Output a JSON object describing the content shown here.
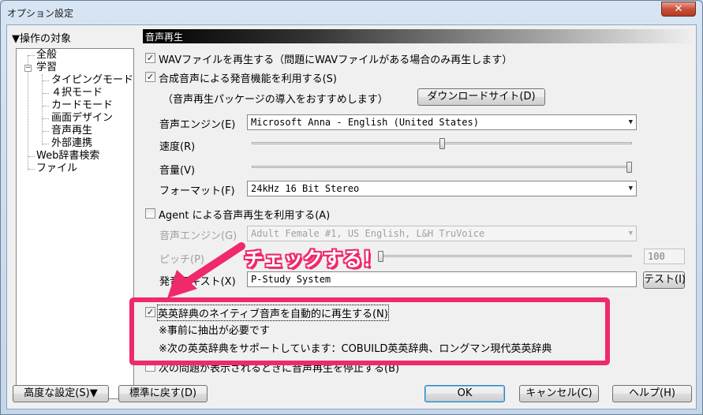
{
  "window": {
    "title": "オプション設定",
    "close_glyph": "✕"
  },
  "tree": {
    "header": "▼操作の対象",
    "items": [
      {
        "label": "全般"
      },
      {
        "label": "学習",
        "expander": "−"
      },
      {
        "label": "タイピングモード"
      },
      {
        "label": "４択モード"
      },
      {
        "label": "カードモード"
      },
      {
        "label": "画面デザイン"
      },
      {
        "label": "音声再生"
      },
      {
        "label": "外部連携"
      },
      {
        "label": "Web辞書検索"
      },
      {
        "label": "ファイル"
      }
    ]
  },
  "section": {
    "title": "音声再生"
  },
  "options": {
    "wav": {
      "label": "WAVファイルを再生する（問題にWAVファイルがある場合のみ再生します）",
      "checked": true
    },
    "tts": {
      "label": "合成音声による発音機能を利用する(S)",
      "checked": true
    },
    "tts_note": "（音声再生パッケージの導入をおすすめします）",
    "download_button": "ダウンロードサイト(D)",
    "engine_label": "音声エンジン(E)",
    "engine_value": "Microsoft Anna - English (United States)",
    "speed_label": "速度(R)",
    "speed_level": 0.5,
    "volume_label": "音量(V)",
    "volume_level": 1.0,
    "format_label": "フォーマット(F)",
    "format_value": "24kHz 16 Bit Stereo",
    "agent": {
      "label": "Agent による音声再生を利用する(A)",
      "checked": false
    },
    "agent_engine_label": "音声エンジン(G)",
    "agent_engine_value": "Adult Female #1, US English, L&H TruVoice",
    "pitch_label": "ピッチ(P)",
    "pitch_value": "100",
    "pitch_level": 0.0,
    "sample_label": "発音テキスト(X)",
    "sample_value": "P-Study System",
    "test_button": "テスト(I)",
    "native": {
      "label": "英英辞典のネイティブ音声を自動的に再生する(N)",
      "checked": true
    },
    "native_note1": "※事前に抽出が必要です",
    "native_note2": "※次の英英辞典をサポートしています：COBUILD英英辞典、ロングマン現代英英辞典",
    "hidden_option": "次の問題が表示されるときに音声再生を停止する(B)"
  },
  "annotation": {
    "text": "チェックする！",
    "color": "#ee2a6b"
  },
  "footer": {
    "advanced_button": "高度な設定(S)▼",
    "reset_button": "標準に戻す(D)",
    "ok_button": "OK",
    "cancel_button": "キャンセル(C)",
    "help_button": "ヘルプ(H)"
  },
  "check_glyph": "✓"
}
